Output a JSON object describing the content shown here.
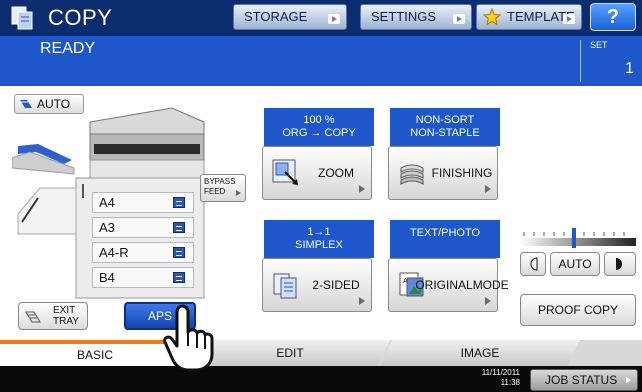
{
  "header": {
    "title": "COPY",
    "tabs": [
      {
        "label": "STORAGE"
      },
      {
        "label": "SETTINGS"
      },
      {
        "label": "TEMPLATE"
      }
    ],
    "help_label": "?"
  },
  "status": {
    "text": "READY",
    "set_label": "SET",
    "set_count": "1"
  },
  "paper": {
    "auto_label": "AUTO",
    "trays": [
      "A4",
      "A3",
      "A4-R",
      "B4"
    ],
    "bypass_label_1": "BYPASS",
    "bypass_label_2": "FEED",
    "exit_tray_1": "EXIT",
    "exit_tray_2": "TRAY",
    "aps_label": "APS"
  },
  "functions": {
    "zoom_status_1": "100 %",
    "zoom_status_2": "ORG → COPY",
    "zoom_label": "ZOOM",
    "finishing_status_1": "NON-SORT",
    "finishing_status_2": "NON-STAPLE",
    "finishing_label": "FINISHING",
    "duplex_status_1": "1→1",
    "duplex_status_2": "SIMPLEX",
    "duplex_label": "2-SIDED",
    "mode_status": "TEXT/PHOTO",
    "mode_label_1": "ORIGINAL",
    "mode_label_2": "MODE"
  },
  "density": {
    "auto_label": "AUTO",
    "proof_label": "PROOF COPY"
  },
  "bottom_tabs": [
    "BASIC",
    "EDIT",
    "IMAGE"
  ],
  "footer": {
    "date": "11/11/2011",
    "time": "11:38",
    "job_status_label": "JOB STATUS"
  },
  "colors": {
    "header_bg": "#0b2c6e",
    "status_bg": "#1d57c9",
    "accent_tab": "#f07a1a"
  }
}
